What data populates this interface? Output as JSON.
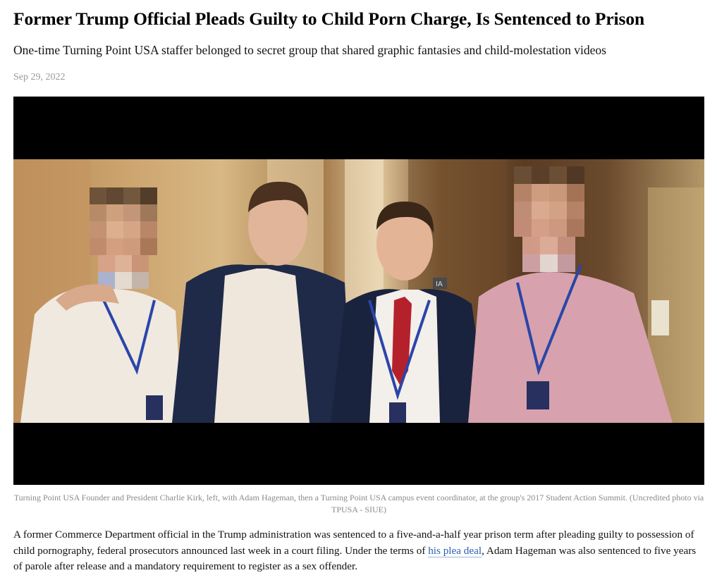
{
  "article": {
    "headline": "Former Trump Official Pleads Guilty to Child Porn Charge, Is Sentenced to Prison",
    "dek": "One-time Turning Point USA staffer belonged to secret group that shared graphic fantasies and child-molestation videos",
    "date": "Sep 29, 2022",
    "photo": {
      "badge_text": "IA",
      "caption": "Turning Point USA Founder and President Charlie Kirk, left, with Adam Hageman, then a Turning Point USA campus event coordinator, at the group's 2017 Student Action Summit. (Uncredited photo via TPUSA - SIUE)"
    },
    "body": {
      "text_before_link": "A former Commerce Department official in the Trump administration was sentenced to a five-and-a-half year prison term after pleading guilty to possession of child pornography, federal prosecutors announced last week in a court filing. Under the terms of ",
      "link_text": "his plea deal",
      "text_after_link": ", Adam Hageman was also sentenced to five years of parole after release and a mandatory requirement to register as a sex offender."
    }
  },
  "colors": {
    "headline": "#000000",
    "date": "#9a9a9a",
    "caption": "#8a8a8a",
    "link": "#2a5db0",
    "media_background": "#000000"
  }
}
